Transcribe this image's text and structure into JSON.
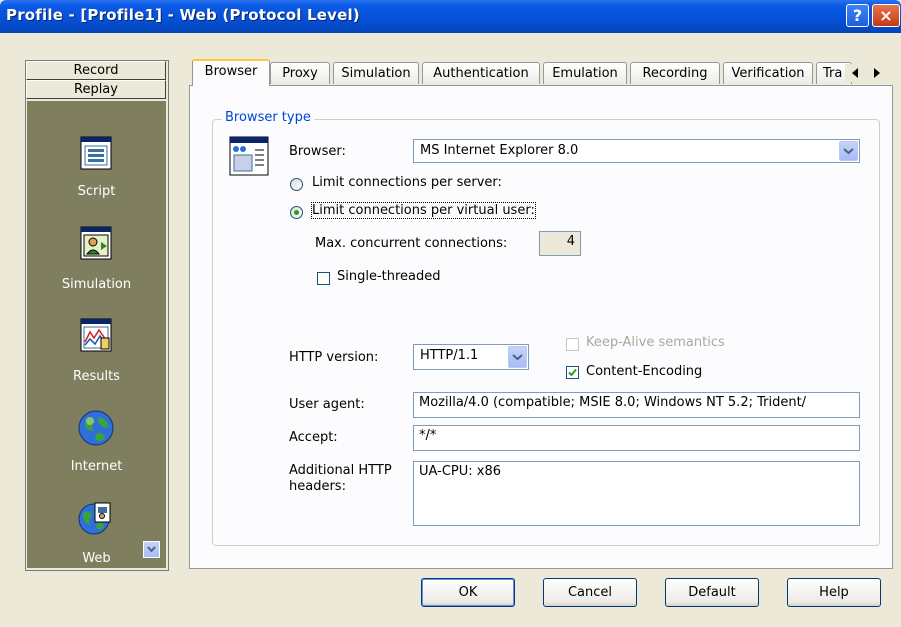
{
  "window": {
    "title": "Profile - [Profile1] - Web (Protocol Level)"
  },
  "caption_buttons": {
    "help": "?",
    "close": "×"
  },
  "left_bar": {
    "buttons": [
      "Record",
      "Replay"
    ],
    "items": [
      {
        "label": "Script",
        "icon": "script-icon"
      },
      {
        "label": "Simulation",
        "icon": "simulation-icon"
      },
      {
        "label": "Results",
        "icon": "results-icon"
      },
      {
        "label": "Internet",
        "icon": "internet-globe-icon"
      },
      {
        "label": "Web",
        "icon": "web-page-globe-icon"
      }
    ]
  },
  "tabs": [
    "Browser",
    "Proxy",
    "Simulation",
    "Authentication",
    "Emulation",
    "Recording",
    "Verification",
    "Tra"
  ],
  "active_tab": "Browser",
  "browser_type": {
    "group_label": "Browser type",
    "browser_label": "Browser:",
    "browser_value": "MS Internet Explorer 8.0",
    "radio_per_server": "Limit connections per server:",
    "radio_per_user": "Limit connections per virtual user:",
    "radio_selected": "per_user",
    "max_conn_label": "Max. concurrent connections:",
    "max_conn_value": "4",
    "single_threaded_label": "Single-threaded",
    "single_threaded_checked": false,
    "http_version_label": "HTTP version:",
    "http_version_value": "HTTP/1.1",
    "keep_alive_label": "Keep-Alive semantics",
    "keep_alive_checked": false,
    "keep_alive_enabled": false,
    "content_encoding_label": "Content-Encoding",
    "content_encoding_checked": true,
    "user_agent_label": "User agent:",
    "user_agent_value": "Mozilla/4.0 (compatible; MSIE 8.0; Windows NT 5.2; Trident/",
    "accept_label": "Accept:",
    "accept_value": "*/*",
    "additional_headers_label": "Additional HTTP headers:",
    "additional_headers_value": "UA-CPU: x86"
  },
  "buttons": {
    "ok": "OK",
    "cancel": "Cancel",
    "default": "Default",
    "help": "Help"
  },
  "colors": {
    "title_bar": "#0650d6",
    "group_label": "#0046d5",
    "left_pane": "#7f7f5f",
    "active_tab_accent": "#ffc83c",
    "check_mark": "#21a121"
  }
}
